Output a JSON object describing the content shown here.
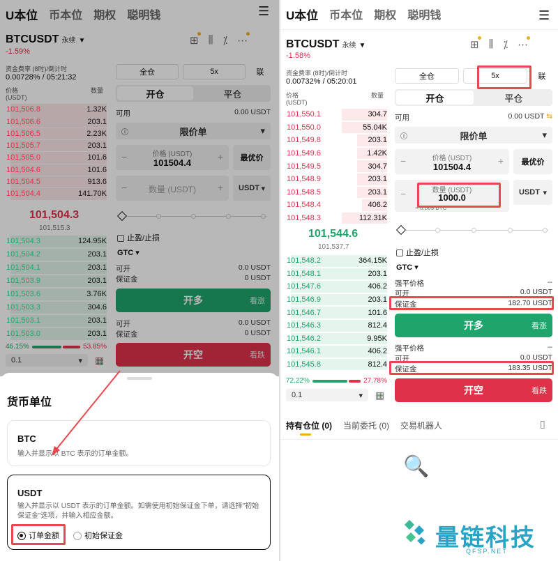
{
  "left": {
    "tabs": [
      "U本位",
      "币本位",
      "期权",
      "聪明钱"
    ],
    "symbol": "BTCUSDT",
    "perp": "永续",
    "change": "-1.59%",
    "funding_label": "资金费率 (8时)/倒计时",
    "funding_value": "0.00728% / 05:21:32",
    "col_price": "价格",
    "col_unit": "(USDT)",
    "col_qty": "数量",
    "asks": [
      [
        "101,506.8",
        "1.32K"
      ],
      [
        "101,506.6",
        "203.1"
      ],
      [
        "101,506.5",
        "2.23K"
      ],
      [
        "101,505.7",
        "203.1"
      ],
      [
        "101,505.0",
        "101.6"
      ],
      [
        "101,504.6",
        "101.6"
      ],
      [
        "101,504.5",
        "913.6"
      ],
      [
        "101,504.4",
        "141.70K"
      ]
    ],
    "mid": "101,504.3",
    "mark": "101,515.3",
    "bids": [
      [
        "101,504.3",
        "124.95K"
      ],
      [
        "101,504.2",
        "203.1"
      ],
      [
        "101,504.1",
        "203.1"
      ],
      [
        "101,503.9",
        "203.1"
      ],
      [
        "101,503.6",
        "3.76K"
      ],
      [
        "101,503.3",
        "304.6"
      ],
      [
        "101,503.1",
        "203.1"
      ],
      [
        "101,503.0",
        "203.1"
      ]
    ],
    "ratio_buy": "46.15%",
    "ratio_sell": "53.85%",
    "depth": "0.1",
    "margin_mode": "全仓",
    "leverage": "5x",
    "link": "联",
    "open_tab": "开仓",
    "close_tab": "平仓",
    "avail_label": "可用",
    "avail_value": "0.00 USDT",
    "order_type": "限价单",
    "price_label": "价格 (USDT)",
    "price_value": "101504.4",
    "best_price": "最优价",
    "qty_placeholder": "数量 (USDT)",
    "qty_unit": "USDT",
    "tpsl": "止盈/止损",
    "tif": "GTC",
    "can_open": "可开",
    "can_open_val": "0.0 USDT",
    "margin": "保证金",
    "margin_val": "0 USDT",
    "long_btn": "开多",
    "long_tag": "看涨",
    "can_open2_val": "0.0 USDT",
    "margin2_val": "0 USDT",
    "short_btn": "开空",
    "short_tag": "看跌",
    "sheet_title": "货币单位",
    "btc_title": "BTC",
    "btc_desc": "输入并显示以 BTC 表示的订单金额。",
    "usdt_title": "USDT",
    "usdt_desc": "输入并显示以 USDT 表示的订单金额。如需使用初始保证金下单，请选择\"初始保证金\"选项，并输入相应金额。",
    "opt_order": "订单金额",
    "opt_margin": "初始保证金"
  },
  "right": {
    "tabs": [
      "U本位",
      "币本位",
      "期权",
      "聪明钱"
    ],
    "symbol": "BTCUSDT",
    "perp": "永续",
    "change": "-1.58%",
    "funding_label": "资金费率 (8时)/倒计时",
    "funding_value": "0.00732% / 05:20:01",
    "col_price": "价格",
    "col_unit": "(USDT)",
    "col_qty": "数量",
    "asks": [
      [
        "101,550.1",
        "304.7"
      ],
      [
        "101,550.0",
        "55.04K"
      ],
      [
        "101,549.8",
        "203.1"
      ],
      [
        "101,549.6",
        "1.42K"
      ],
      [
        "101,549.5",
        "304.7"
      ],
      [
        "101,548.9",
        "203.1"
      ],
      [
        "101,548.5",
        "203.1"
      ],
      [
        "101,548.4",
        "406.2"
      ],
      [
        "101,548.3",
        "112.31K"
      ]
    ],
    "mid": "101,544.6",
    "mark": "101,537.7",
    "bids": [
      [
        "101,548.2",
        "364.15K"
      ],
      [
        "101,548.1",
        "203.1"
      ],
      [
        "101,547.6",
        "406.2"
      ],
      [
        "101,546.9",
        "203.1"
      ],
      [
        "101,546.7",
        "101.6"
      ],
      [
        "101,546.3",
        "812.4"
      ],
      [
        "101,546.2",
        "9.95K"
      ],
      [
        "101,546.1",
        "406.2"
      ],
      [
        "101,545.8",
        "812.4"
      ]
    ],
    "ratio_buy": "72.22%",
    "ratio_sell": "27.78%",
    "depth": "0.1",
    "margin_mode": "全仓",
    "leverage": "5x",
    "link": "联",
    "open_tab": "开仓",
    "close_tab": "平仓",
    "avail_label": "可用",
    "avail_value": "0.00 USDT",
    "order_type": "限价单",
    "price_label": "价格 (USDT)",
    "price_value": "101504.4",
    "best_price": "最优价",
    "qty_label": "数量 (USDT)",
    "qty_value": "1000.0",
    "qty_sub": "≈ 0.009 BTC",
    "qty_unit": "USDT",
    "tpsl": "止盈/止损",
    "tif": "GTC",
    "liq_label": "强平价格",
    "liq_val": "--",
    "can_open": "可开",
    "can_open_val": "0.0 USDT",
    "margin": "保证金",
    "margin_val": "182.70 USDT",
    "long_btn": "开多",
    "long_tag": "看涨",
    "liq2_val": "--",
    "can_open2_val": "0.0 USDT",
    "margin2_val": "183.35 USDT",
    "short_btn": "开空",
    "short_tag": "看跌",
    "bottom_tabs": [
      "持有仓位 (0)",
      "当前委托 (0)",
      "交易机器人"
    ],
    "watermark": "量链科技",
    "watermark_sub": "QFSP.NET"
  },
  "colors": {
    "red": "#e0314b",
    "green": "#1fa56c",
    "highlight": "#e8484e"
  }
}
